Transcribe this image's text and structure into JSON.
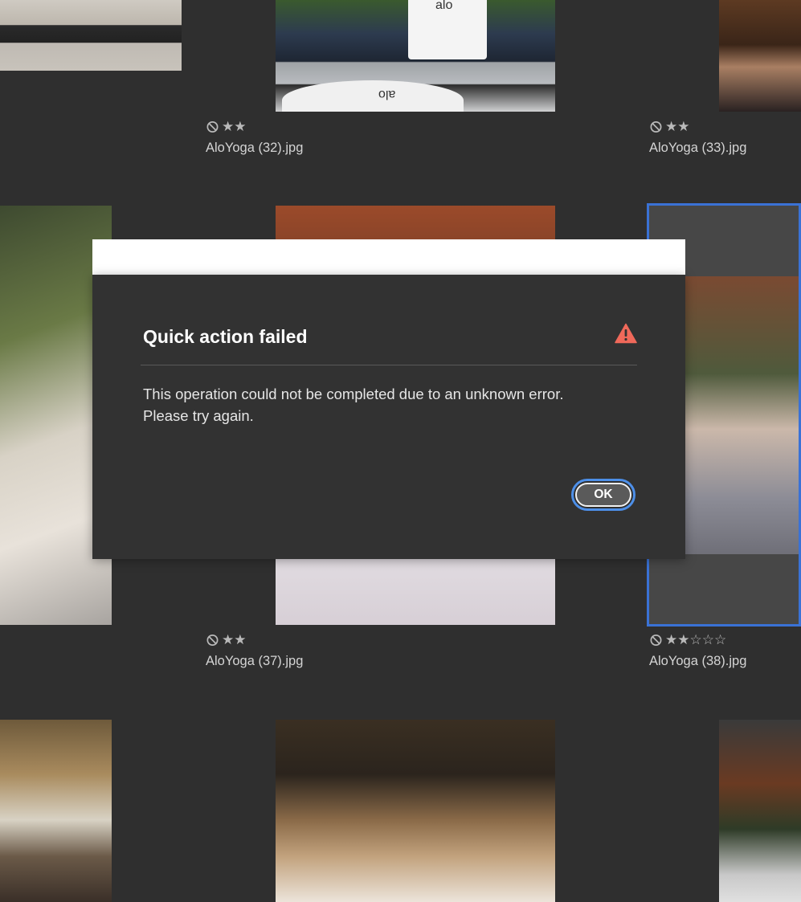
{
  "grid": {
    "tiles": [
      {
        "filename": "AloYoga (32).jpg",
        "rating": "★★",
        "rejected": true
      },
      {
        "filename": "AloYoga (33).jpg",
        "rating": "★★",
        "rejected": true
      },
      {
        "filename": "AloYoga (37).jpg",
        "rating": "★★",
        "rejected": true
      },
      {
        "filename": "AloYoga (38).jpg",
        "rating": "★★☆☆☆",
        "rejected": true
      }
    ],
    "photo_text": {
      "bag_logo": "alo",
      "cushion_logo": "alo"
    }
  },
  "dialog": {
    "title": "Quick action failed",
    "message_line1": "This operation could not be completed due to an unknown error.",
    "message_line2": "Please try again.",
    "ok_label": "OK",
    "alert_color": "#e34850"
  },
  "colors": {
    "background": "#2f2f2f",
    "dialog_bg": "#323232",
    "selection_border": "#3a72d6",
    "focus_ring": "#4d8fe8"
  }
}
